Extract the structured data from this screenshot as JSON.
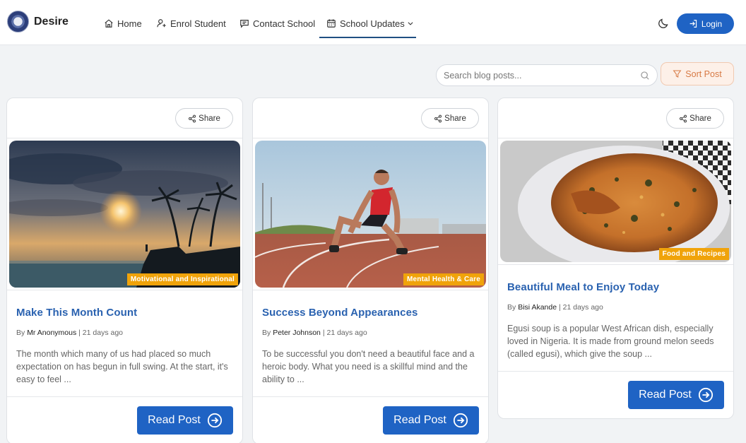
{
  "brand": {
    "name": "Desire"
  },
  "nav": {
    "home": "Home",
    "enrol": "Enrol Student",
    "contact": "Contact School",
    "updates": "School Updates"
  },
  "header": {
    "login_label": "Login"
  },
  "search": {
    "placeholder": "Search blog posts..."
  },
  "sort": {
    "label": "Sort Post"
  },
  "share_label": "Share",
  "read_label": "Read Post",
  "posts": [
    {
      "category": "Motivational and Inspirational",
      "title": "Make This Month Count",
      "by": "By",
      "author": "Mr Anonymous",
      "age": "21 days ago",
      "excerpt": "The month which many of us had placed so much expectation on has begun in full swing. At the start, it's easy to feel ..."
    },
    {
      "category": "Mental Health & Care",
      "title": "Success Beyond Appearances",
      "by": "By",
      "author": "Peter Johnson",
      "age": "21 days ago",
      "excerpt": "To be successful you don't need a beautiful face and a heroic body. What you need is a skillful mind and the ability to ..."
    },
    {
      "category": "Food and Recipes",
      "title": "Beautiful Meal to Enjoy Today",
      "by": "By",
      "author": "Bisi Akande",
      "age": "21 days ago",
      "excerpt": "Egusi soup is a popular West African dish, especially loved in Nigeria. It is made from ground melon seeds (called egusi), which give the soup ..."
    }
  ],
  "colors": {
    "primary": "#1f63c4",
    "title_blue": "#2a62b0",
    "badge": "#f0a30a",
    "sort_text": "#d77a45",
    "background": "#f1f3f5"
  },
  "icons": {
    "home": "home-icon",
    "enrol": "user-plus-icon",
    "contact": "chat-icon",
    "updates": "calendar-icon",
    "theme": "moon-icon",
    "login": "login-icon",
    "search": "search-icon",
    "sort": "filter-icon",
    "share": "share-icon",
    "read": "arrow-circle-right-icon"
  }
}
